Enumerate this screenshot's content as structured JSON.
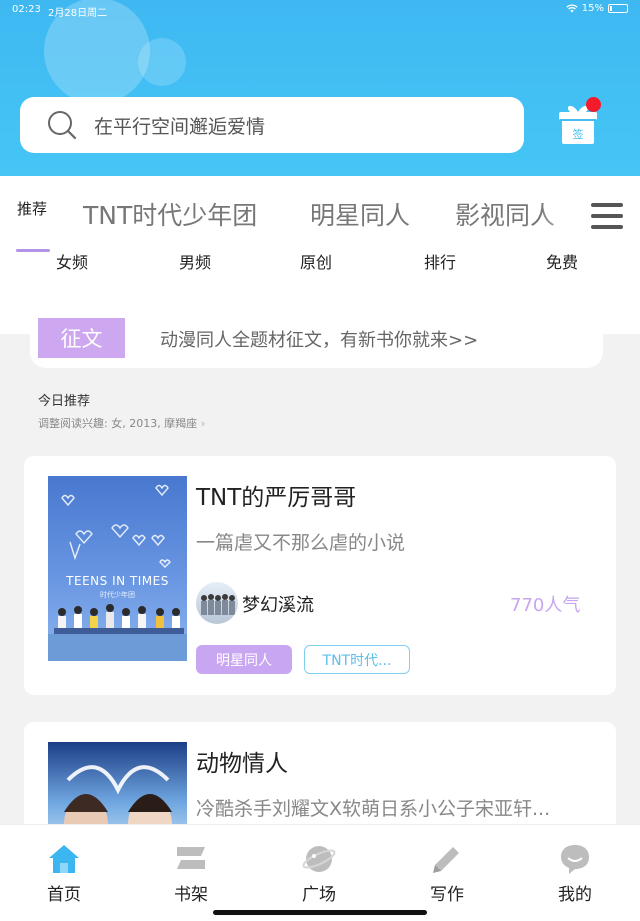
{
  "status_bar": {
    "time": "02:23",
    "date": "2月28日周二",
    "battery": "15%",
    "battery_level": 0.15
  },
  "search": {
    "placeholder": "在平行空间邂逅爱情"
  },
  "sign_in": {
    "label": "签"
  },
  "category_tabs": [
    {
      "label": "推荐",
      "selected": true
    },
    {
      "label": "TNT时代少年团"
    },
    {
      "label": "明星同人"
    },
    {
      "label": "影视同人"
    }
  ],
  "sub_tabs": [
    "女频",
    "男频",
    "原创",
    "排行",
    "免费"
  ],
  "contest": {
    "badge": "征文",
    "text": "动漫同人全题材征文，有新书你就来>>"
  },
  "today": {
    "title": "今日推荐",
    "interest": "调整阅读兴趣: 女, 2013, 摩羯座"
  },
  "books": [
    {
      "title": "TNT的严厉哥哥",
      "desc": "一篇虐又不那么虐的小说",
      "author": "梦幻溪流",
      "popularity": "770人气",
      "tags": [
        "明星同人",
        "TNT时代..."
      ],
      "cover_title": "TEENS IN TIMES",
      "cover_sub": "时代少年团"
    },
    {
      "title": "动物情人",
      "desc": "冷酷杀手刘耀文X软萌日系小公子宋亚轩..."
    }
  ],
  "bottom_nav": [
    {
      "label": "首页",
      "icon": "home-icon",
      "active": true
    },
    {
      "label": "书架",
      "icon": "bookshelf-icon"
    },
    {
      "label": "广场",
      "icon": "planet-icon"
    },
    {
      "label": "写作",
      "icon": "pen-icon"
    },
    {
      "label": "我的",
      "icon": "chat-bubble-icon"
    }
  ],
  "colors": {
    "header": "#3fb8f2",
    "accent_purple": "#c9a6f1",
    "accent_blue": "#5cbfe6",
    "badge_red": "#f31b2a"
  }
}
